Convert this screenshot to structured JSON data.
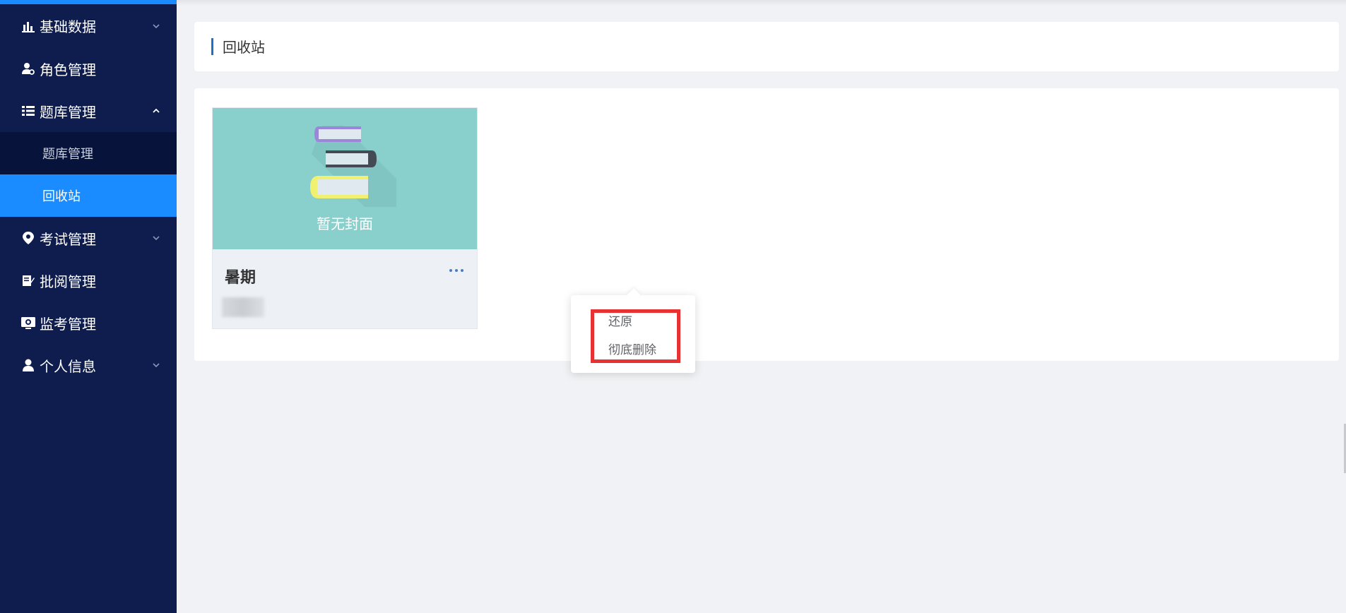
{
  "sidebar": {
    "items": [
      {
        "label": "基础数据",
        "icon": "bar-chart-icon",
        "arrow": "chevron-down"
      },
      {
        "label": "角色管理",
        "icon": "user-settings-icon",
        "arrow": ""
      },
      {
        "label": "题库管理",
        "icon": "list-icon",
        "arrow": "chevron-up"
      },
      {
        "label": "考试管理",
        "icon": "location-pin-icon",
        "arrow": "chevron-down"
      },
      {
        "label": "批阅管理",
        "icon": "edit-document-icon",
        "arrow": ""
      },
      {
        "label": "监考管理",
        "icon": "monitor-camera-icon",
        "arrow": ""
      },
      {
        "label": "个人信息",
        "icon": "user-icon",
        "arrow": "chevron-down"
      }
    ],
    "submenu": [
      {
        "label": "题库管理",
        "active": false
      },
      {
        "label": "回收站",
        "active": true
      }
    ]
  },
  "page": {
    "title": "回收站"
  },
  "card": {
    "cover_text": "暂无封面",
    "name": "暑期",
    "more_icon": "more-horizontal-icon"
  },
  "dropdown": {
    "options": [
      "还原",
      "彻底删除"
    ]
  },
  "colors": {
    "sidebar_bg": "#0e1d4e",
    "active_bg": "#1a8cff",
    "cover_bg": "#89cfcc",
    "highlight": "#e63232"
  }
}
